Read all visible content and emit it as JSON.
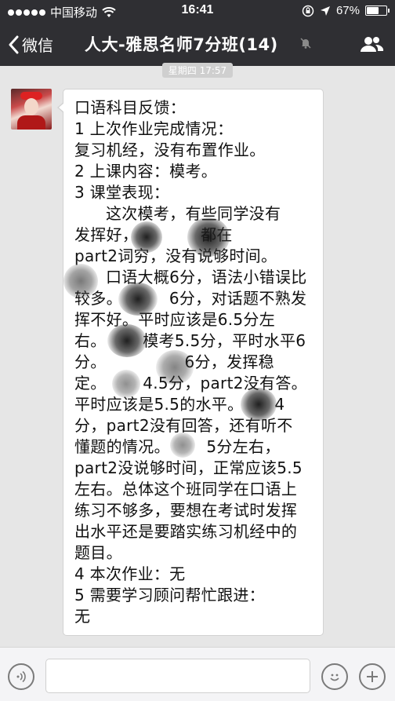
{
  "status_bar": {
    "carrier": "中国移动",
    "time": "16:41",
    "battery_percent": "67%",
    "battery_level": 0.67
  },
  "nav": {
    "back_label": "微信",
    "title": "人大-雅思名师7分班(14)"
  },
  "chat": {
    "timestamp": "星期四 17:57",
    "message_lines": [
      "口语科目反馈：",
      "1 上次作业完成情况：",
      "复习机经，没有布置作业。",
      "2 上课内容：模考。",
      "3 课堂表现：",
      "      这次模考，有些同学没有",
      "发挥好，            都在",
      "part2词穷，没有说够时间。",
      "      口语大概6分，语法小错误比",
      "较多。         6分，对话题不熟发",
      "挥不好。平时应该是6.5分左",
      "右。       模考5.5分，平时水平6",
      "分。               6分，发挥稳",
      "定。       4.5分，part2没有答。",
      "平时应该是5.5的水平。      4",
      "分，part2没有回答，还有听不",
      "懂题的情况。       5分左右，",
      "part2没说够时间，正常应该5.5",
      "左右。总体这个班同学在口语上",
      "练习不够多，要想在考试时发挥",
      "出水平还是要踏实练习机经中的",
      "题目。",
      "4 本次作业：无",
      "5 需要学习顾问帮忙跟进：",
      "无"
    ]
  },
  "icons": {
    "wifi": "wifi-icon",
    "location": "location-arrow-icon",
    "lock_rotation": "rotation-lock-icon",
    "back": "chevron-left-icon",
    "mute": "mute-bell-icon",
    "group": "group-members-icon",
    "voice": "voice-icon",
    "emoji": "emoji-icon",
    "plus": "plus-icon"
  },
  "colors": {
    "bar_background": "#2f2f33",
    "chat_background": "#e6e6e6",
    "bubble": "#ffffff"
  }
}
